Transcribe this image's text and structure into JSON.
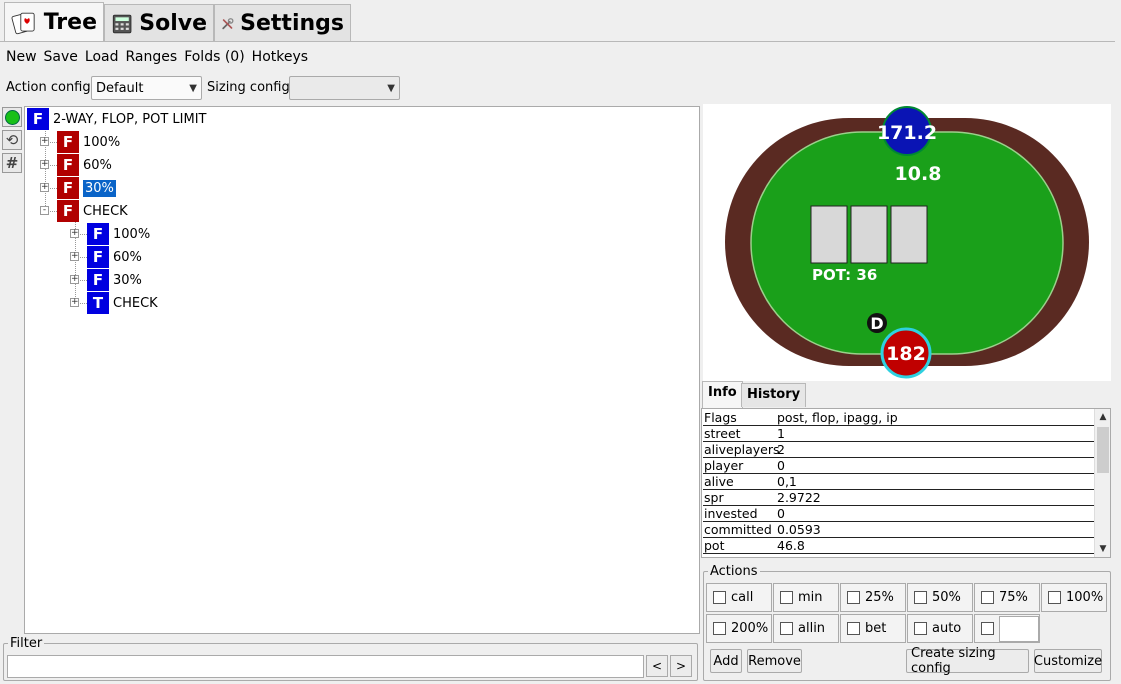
{
  "tabs": [
    {
      "label": "Tree",
      "icon": "playing-cards-icon",
      "active": true
    },
    {
      "label": "Solve",
      "icon": "calculator-icon",
      "active": false
    },
    {
      "label": "Settings",
      "icon": "tools-icon",
      "active": false
    }
  ],
  "menu": [
    "New",
    "Save",
    "Load",
    "Ranges",
    "Folds (0)",
    "Hotkeys"
  ],
  "config": {
    "action_label": "Action config:",
    "action_value": "Default",
    "sizing_label": "Sizing config:",
    "sizing_value": ""
  },
  "tree": {
    "root": {
      "badge": "F",
      "color": "blue",
      "label": "2-WAY, FLOP, POT LIMIT"
    },
    "nodes": [
      {
        "badge": "F",
        "color": "red",
        "label": "100%",
        "expander": "+",
        "selected": false
      },
      {
        "badge": "F",
        "color": "red",
        "label": "60%",
        "expander": "+",
        "selected": false
      },
      {
        "badge": "F",
        "color": "red",
        "label": "30%",
        "expander": "+",
        "selected": true
      },
      {
        "badge": "F",
        "color": "red",
        "label": "CHECK",
        "expander": "-",
        "selected": false
      }
    ],
    "children": [
      {
        "badge": "F",
        "color": "blue",
        "label": "100%",
        "expander": "+"
      },
      {
        "badge": "F",
        "color": "blue",
        "label": "60%",
        "expander": "+"
      },
      {
        "badge": "F",
        "color": "blue",
        "label": "30%",
        "expander": "+"
      },
      {
        "badge": "T",
        "color": "blue",
        "label": "CHECK",
        "expander": "+"
      }
    ]
  },
  "filter": {
    "title": "Filter",
    "value": "",
    "prev": "<",
    "next": ">"
  },
  "table": {
    "top_stack": "171.2",
    "top_bet": "10.8",
    "pot": "POT: 36",
    "dealer": "D",
    "bottom_stack": "182",
    "colors": {
      "felt": "#1aa01a",
      "rail": "#5a2a22",
      "top_chip": "#0a14b4",
      "bottom_chip": "#c00000"
    }
  },
  "info_tabs": [
    "Info",
    "History"
  ],
  "info_rows": [
    {
      "key": "Flags",
      "value": "post, flop, ipagg, ip"
    },
    {
      "key": "street",
      "value": "1"
    },
    {
      "key": "aliveplayers",
      "value": "2"
    },
    {
      "key": "player",
      "value": "0"
    },
    {
      "key": "alive",
      "value": "0,1"
    },
    {
      "key": "spr",
      "value": "2.9722"
    },
    {
      "key": "invested",
      "value": "0"
    },
    {
      "key": "committed",
      "value": "0.0593"
    },
    {
      "key": "pot",
      "value": "46.8"
    }
  ],
  "actions": {
    "title": "Actions",
    "row1": [
      "call",
      "min",
      "25%",
      "50%",
      "75%",
      "100%"
    ],
    "row2": [
      "200%",
      "allin",
      "bet",
      "auto"
    ],
    "custom_value": "",
    "buttons": {
      "add": "Add",
      "remove": "Remove",
      "create": "Create sizing config",
      "customize": "Customize"
    }
  }
}
